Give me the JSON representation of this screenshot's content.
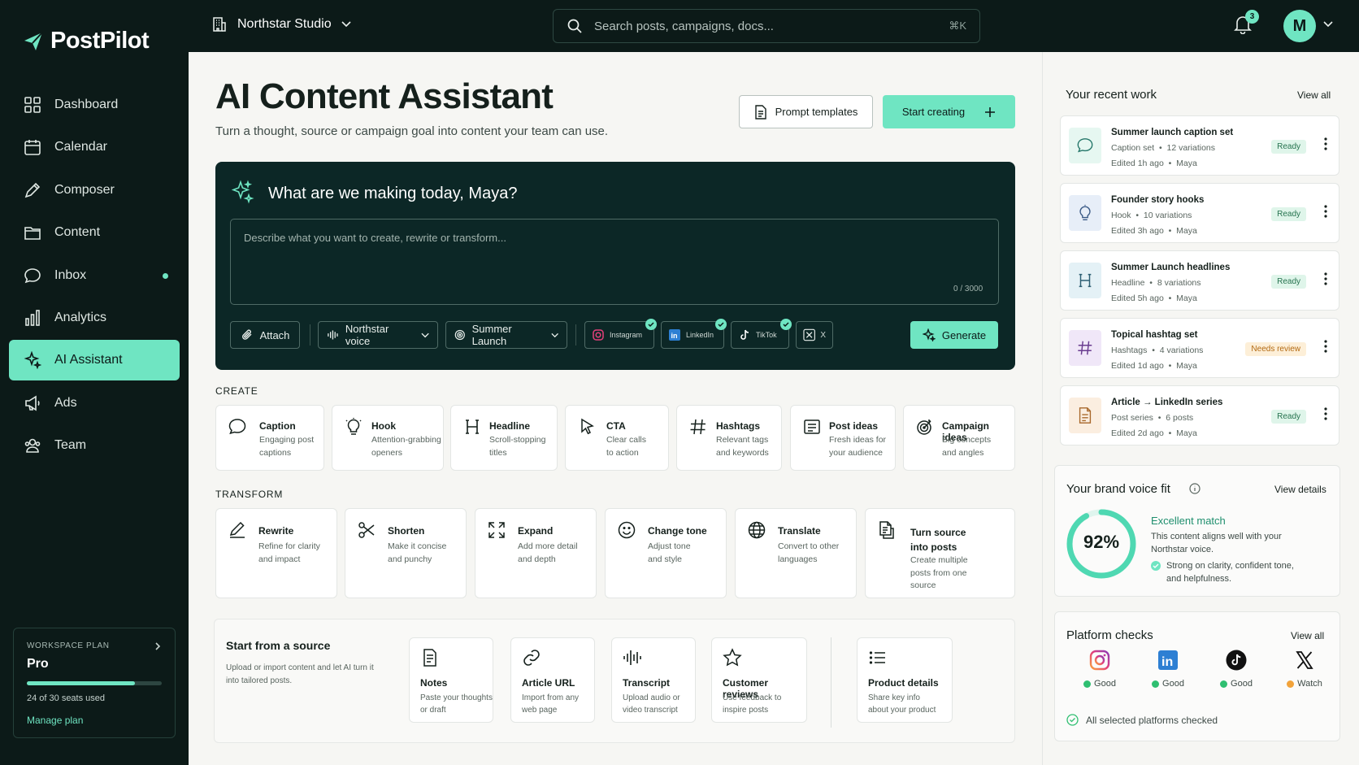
{
  "app": {
    "name": "PostPilot"
  },
  "sidebar": {
    "items": [
      {
        "label": "Dashboard"
      },
      {
        "label": "Calendar"
      },
      {
        "label": "Composer"
      },
      {
        "label": "Content"
      },
      {
        "label": "Inbox"
      },
      {
        "label": "Analytics"
      },
      {
        "label": "AI Assistant"
      },
      {
        "label": "Ads"
      },
      {
        "label": "Team"
      }
    ],
    "plan": {
      "kicker": "WORKSPACE PLAN",
      "name": "Pro",
      "seats_text": "24 of 30 seats used",
      "seats_used": 24,
      "seats_total": 30,
      "manage_label": "Manage plan"
    }
  },
  "topbar": {
    "workspace": "Northstar Studio",
    "search_placeholder": "Search posts, campaigns, docs...",
    "search_shortcut": "⌘K",
    "notifications": "3",
    "avatar_initial": "M"
  },
  "header": {
    "title": "AI Content Assistant",
    "subtitle": "Turn a thought, source or campaign goal into content your team can use.",
    "prompt_templates": "Prompt templates",
    "start_creating": "Start creating"
  },
  "composer": {
    "greeting": "What are we making today, Maya?",
    "placeholder": "Describe what you want to create, rewrite or transform...",
    "counter": "0 / 3000",
    "attach": "Attach",
    "voice": "Northstar voice",
    "campaign": "Summer Launch",
    "platforms": [
      {
        "label": "Instagram",
        "checked": true
      },
      {
        "label": "LinkedIn",
        "checked": true
      },
      {
        "label": "TikTok",
        "checked": true
      },
      {
        "label": "X",
        "checked": false
      }
    ],
    "generate": "Generate"
  },
  "create": {
    "heading": "CREATE",
    "cards": [
      {
        "title": "Caption",
        "desc1": "Engaging post",
        "desc2": "captions",
        "icon": "chat-bubble-icon"
      },
      {
        "title": "Hook",
        "desc1": "Attention-grabbing",
        "desc2": "openers",
        "icon": "lightbulb-icon"
      },
      {
        "title": "Headline",
        "desc1": "Scroll-stopping",
        "desc2": "titles",
        "icon": "heading-icon"
      },
      {
        "title": "CTA",
        "desc1": "Clear calls",
        "desc2": "to action",
        "icon": "cursor-icon"
      },
      {
        "title": "Hashtags",
        "desc1": "Relevant tags",
        "desc2": "and keywords",
        "icon": "hashtag-icon"
      },
      {
        "title": "Post ideas",
        "desc1": "Fresh ideas for",
        "desc2": "your audience",
        "icon": "list-card-icon"
      },
      {
        "title": "Campaign ideas",
        "desc1": "Big concepts",
        "desc2": "and angles",
        "icon": "target-icon"
      }
    ]
  },
  "transform": {
    "heading": "TRANSFORM",
    "cards": [
      {
        "title": "Rewrite",
        "desc1": "Refine for clarity",
        "desc2": "and impact",
        "desc3": "",
        "icon": "pencil-icon"
      },
      {
        "title": "Shorten",
        "desc1": "Make it concise",
        "desc2": "and punchy",
        "desc3": "",
        "icon": "scissors-icon"
      },
      {
        "title": "Expand",
        "desc1": "Add more detail",
        "desc2": "and depth",
        "desc3": "",
        "icon": "expand-icon"
      },
      {
        "title": "Change tone",
        "desc1": "Adjust tone",
        "desc2": "and style",
        "desc3": "",
        "icon": "smile-icon"
      },
      {
        "title": "Translate",
        "desc1": "Convert to other",
        "desc2": "languages",
        "desc3": "",
        "icon": "globe-icon"
      },
      {
        "title": "Turn source",
        "title2": "into posts",
        "desc1": "Create multiple",
        "desc2": "posts from one",
        "desc3": "source",
        "icon": "docs-icon"
      }
    ]
  },
  "source": {
    "heading": "Start from a source",
    "desc": "Upload or import content and let AI turn it into tailored posts.",
    "cards": [
      {
        "title": "Notes",
        "desc1": "Paste your thoughts",
        "desc2": "or draft",
        "icon": "note-icon"
      },
      {
        "title": "Article URL",
        "desc1": "Import from any",
        "desc2": "web page",
        "icon": "link-icon"
      },
      {
        "title": "Transcript",
        "desc1": "Upload audio or",
        "desc2": "video transcript",
        "icon": "waveform-icon"
      },
      {
        "title": "Customer reviews",
        "desc1": "Use feedback to",
        "desc2": "inspire posts",
        "icon": "star-icon"
      },
      {
        "title": "Product details",
        "desc1": "Share key info",
        "desc2": "about your product",
        "icon": "list-icon"
      }
    ]
  },
  "recent": {
    "heading": "Your recent work",
    "view_all": "View all",
    "items": [
      {
        "title": "Summer launch caption set",
        "type": "Caption set",
        "variations": "12 variations",
        "edited": "Edited 1h ago",
        "author": "Maya",
        "status": "Ready",
        "icon": "chat-bubble-icon",
        "tint": "#e6f7f1"
      },
      {
        "title": "Founder story hooks",
        "type": "Hook",
        "variations": "10 variations",
        "edited": "Edited 3h ago",
        "author": "Maya",
        "status": "Ready",
        "icon": "lightbulb-icon",
        "tint": "#e7eef8"
      },
      {
        "title": "Summer Launch headlines",
        "type": "Headline",
        "variations": "8 variations",
        "edited": "Edited 5h ago",
        "author": "Maya",
        "status": "Ready",
        "icon": "heading-icon",
        "tint": "#e4f1f6"
      },
      {
        "title": "Topical hashtag set",
        "type": "Hashtags",
        "variations": "4 variations",
        "edited": "Edited 1d ago",
        "author": "Maya",
        "status": "Needs review",
        "icon": "hashtag-icon",
        "tint": "#f0e7f8"
      },
      {
        "title": "Article → LinkedIn series",
        "type": "Post series",
        "variations": "6 posts",
        "edited": "Edited 2d ago",
        "author": "Maya",
        "status": "Ready",
        "icon": "document-icon",
        "tint": "#fbeee0"
      }
    ]
  },
  "brand": {
    "heading": "Your brand voice fit",
    "view_details": "View details",
    "score_label": "92%",
    "score": 0.92,
    "match": "Excellent match",
    "desc": "This content aligns well with your Northstar voice.",
    "point_line1": "Strong on clarity, confident tone,",
    "point_line2": "and helpfulness."
  },
  "platforms": {
    "heading": "Platform checks",
    "view_all": "View all",
    "items": [
      {
        "name": "instagram-logo",
        "status": "Good",
        "color": "#2fbf71"
      },
      {
        "name": "linkedin-logo",
        "status": "Good",
        "color": "#2fbf71"
      },
      {
        "name": "tiktok-logo",
        "status": "Good",
        "color": "#2fbf71"
      },
      {
        "name": "x-logo",
        "status": "Watch",
        "color": "#f2a33a"
      }
    ],
    "footer": "All selected platforms checked"
  },
  "colors": {
    "accent": "#6fe5c2",
    "dark": "#0c1a18",
    "hero": "#0c2726",
    "warning": "#f2a33a"
  }
}
